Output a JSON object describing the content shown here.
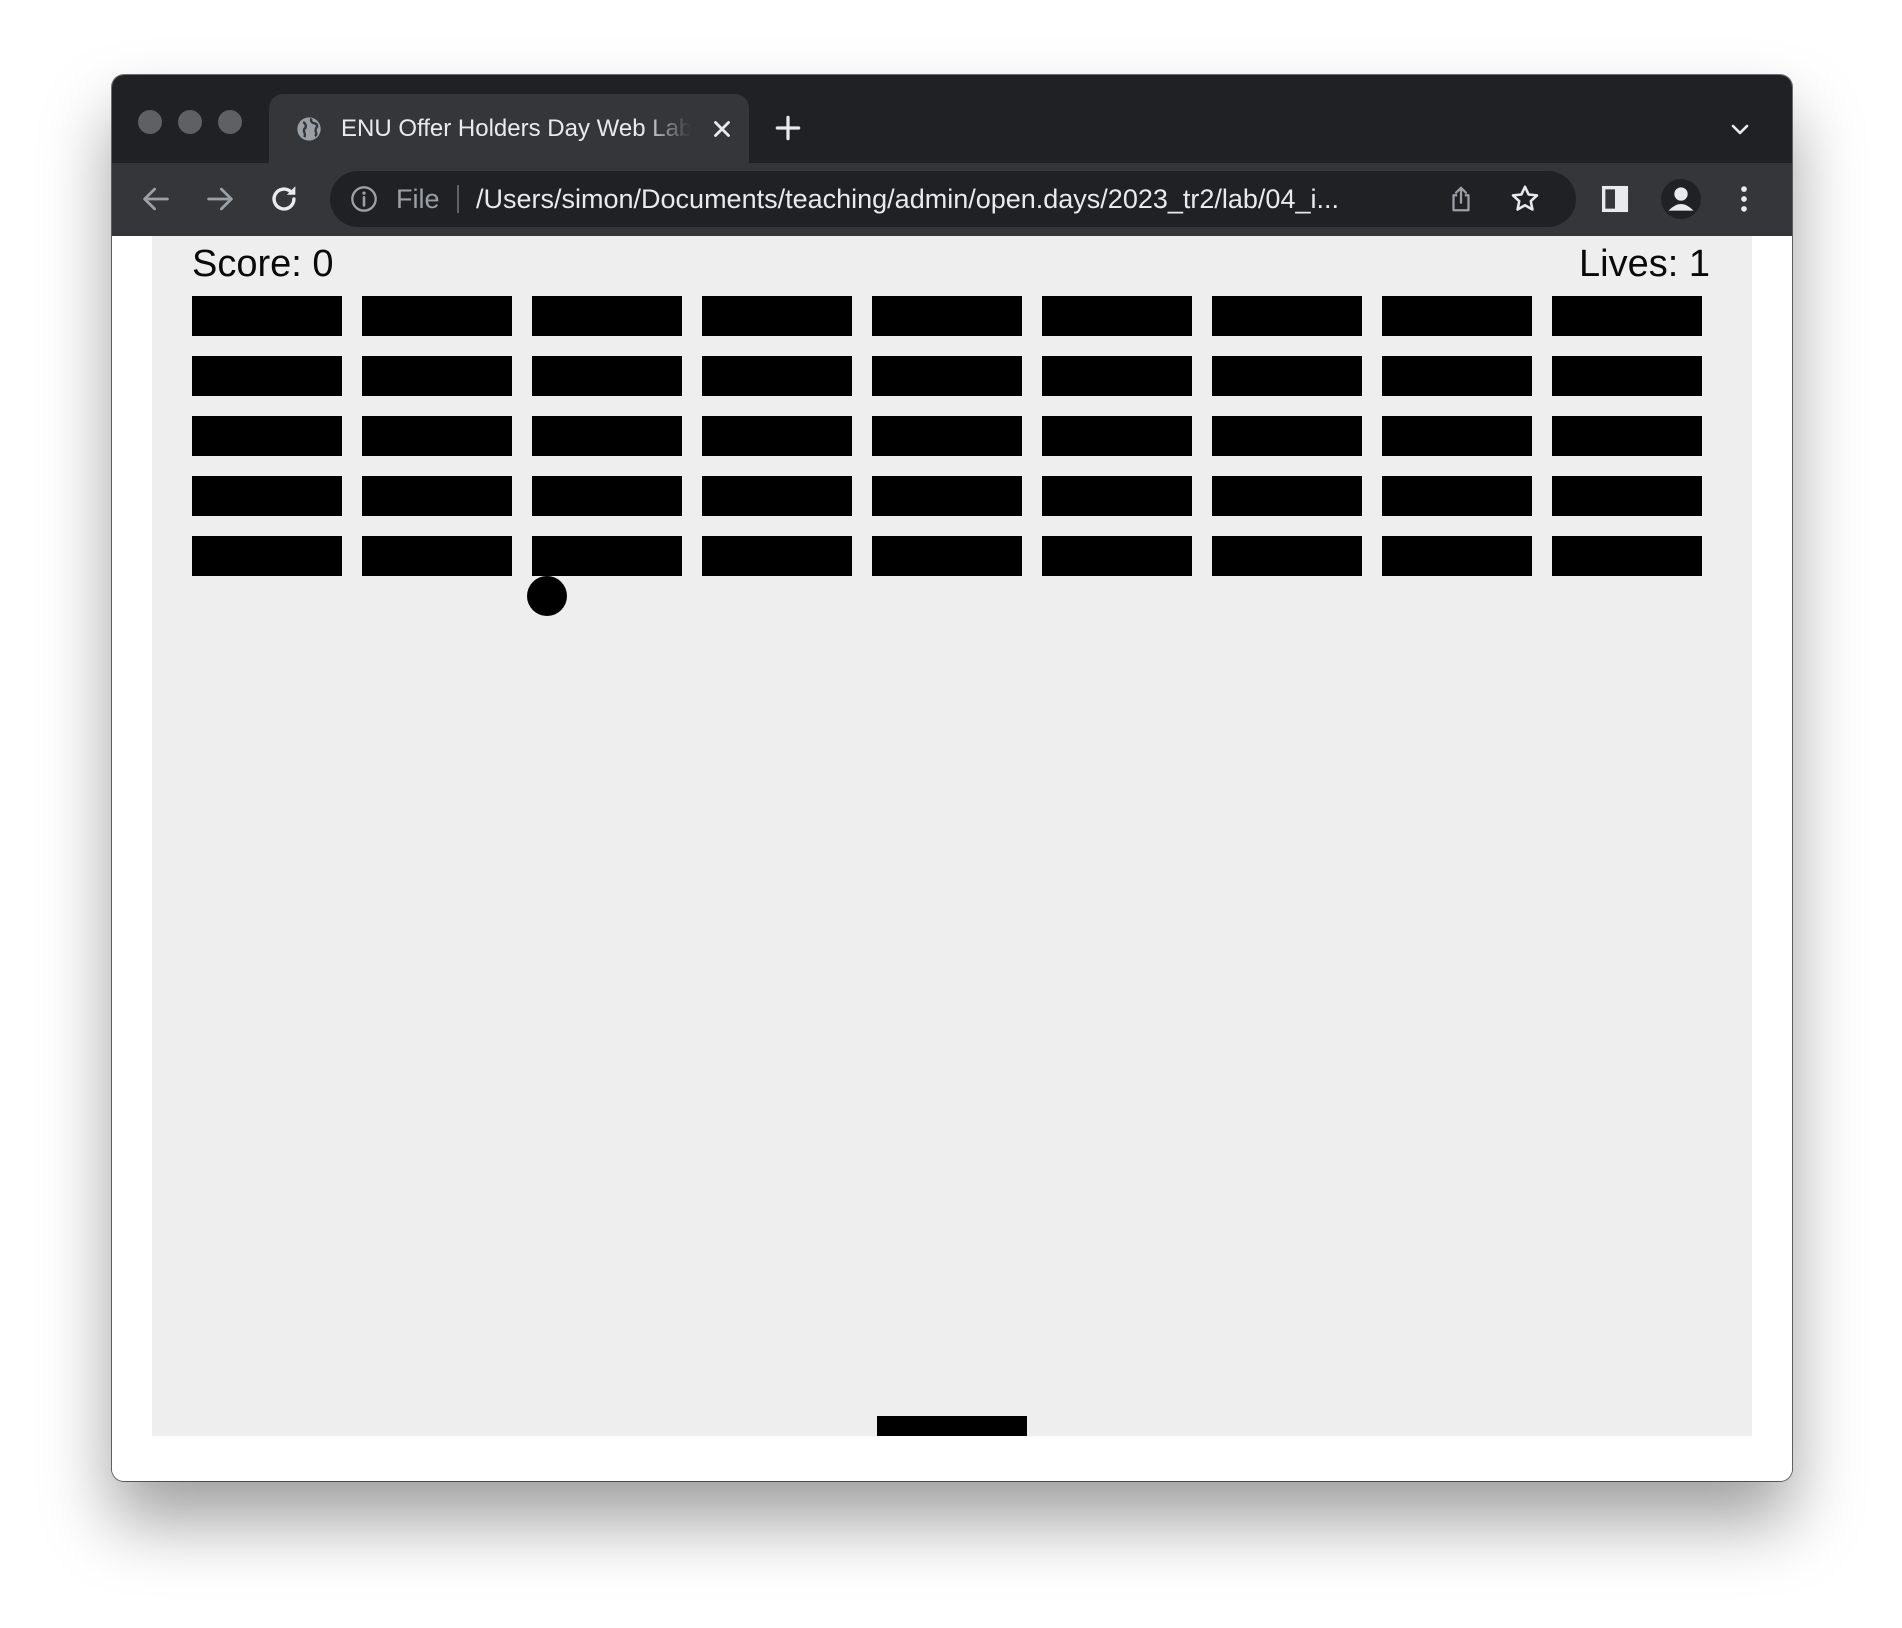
{
  "browser": {
    "tab": {
      "title": "ENU Offer Holders Day Web Lab",
      "favicon": "globe-icon"
    },
    "address_bar": {
      "scheme_label": "File",
      "url": "/Users/simon/Documents/teaching/admin/open.days/2023_tr2/lab/04_i..."
    }
  },
  "game": {
    "score_label": "Score: 0",
    "lives_label": "Lives: 1",
    "score": 0,
    "lives": 1,
    "bricks": {
      "rows": 5,
      "columns": 9
    },
    "colors": {
      "canvas": "#eeeeee",
      "brick": "#000000",
      "ball": "#000000",
      "paddle": "#000000"
    }
  }
}
